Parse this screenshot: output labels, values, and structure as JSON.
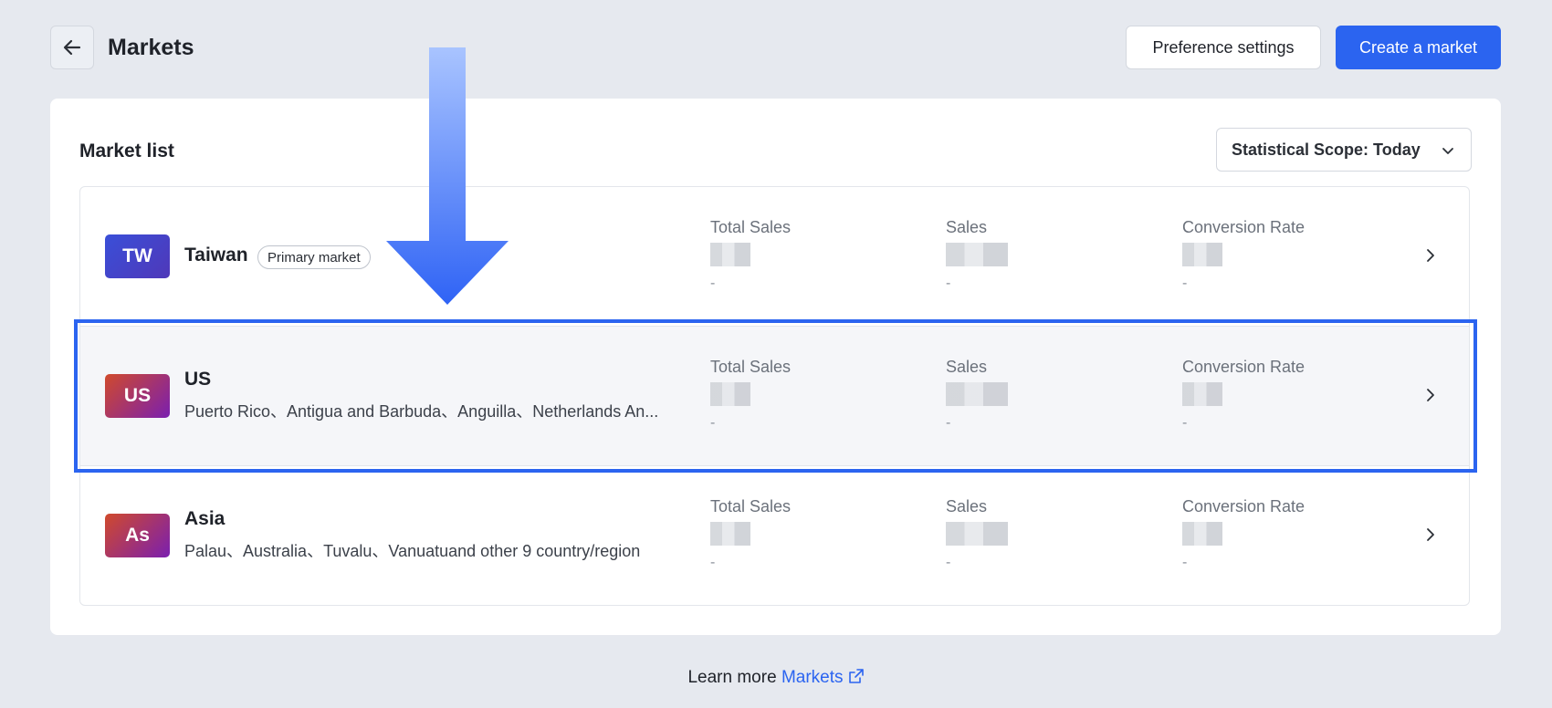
{
  "header": {
    "title": "Markets",
    "preference_label": "Preference settings",
    "create_label": "Create a market"
  },
  "card": {
    "title": "Market list",
    "scope_label": "Statistical Scope: Today"
  },
  "markets": [
    {
      "code": "TW",
      "name": "Taiwan",
      "tag": "Primary market",
      "regions": "",
      "stats": [
        {
          "label": "Total Sales",
          "sub": "-"
        },
        {
          "label": "Sales",
          "sub": "-"
        },
        {
          "label": "Conversion Rate",
          "sub": "-"
        }
      ]
    },
    {
      "code": "US",
      "name": "US",
      "tag": "",
      "regions": "Puerto Rico、Antigua and Barbuda、Anguilla、Netherlands An...",
      "stats": [
        {
          "label": "Total Sales",
          "sub": "-"
        },
        {
          "label": "Sales",
          "sub": "-"
        },
        {
          "label": "Conversion Rate",
          "sub": "-"
        }
      ]
    },
    {
      "code": "As",
      "name": "Asia",
      "tag": "",
      "regions": "Palau、Australia、Tuvalu、Vanuatuand other 9 country/region",
      "stats": [
        {
          "label": "Total Sales",
          "sub": "-"
        },
        {
          "label": "Sales",
          "sub": "-"
        },
        {
          "label": "Conversion Rate",
          "sub": "-"
        }
      ]
    }
  ],
  "footer": {
    "prefix": "Learn more",
    "link": "Markets"
  },
  "colors": {
    "accent": "#2b64f0",
    "background": "#e6e9ef"
  },
  "icons": [
    "back-arrow-icon",
    "chevron-down-icon",
    "chevron-right-icon",
    "external-link-icon"
  ]
}
